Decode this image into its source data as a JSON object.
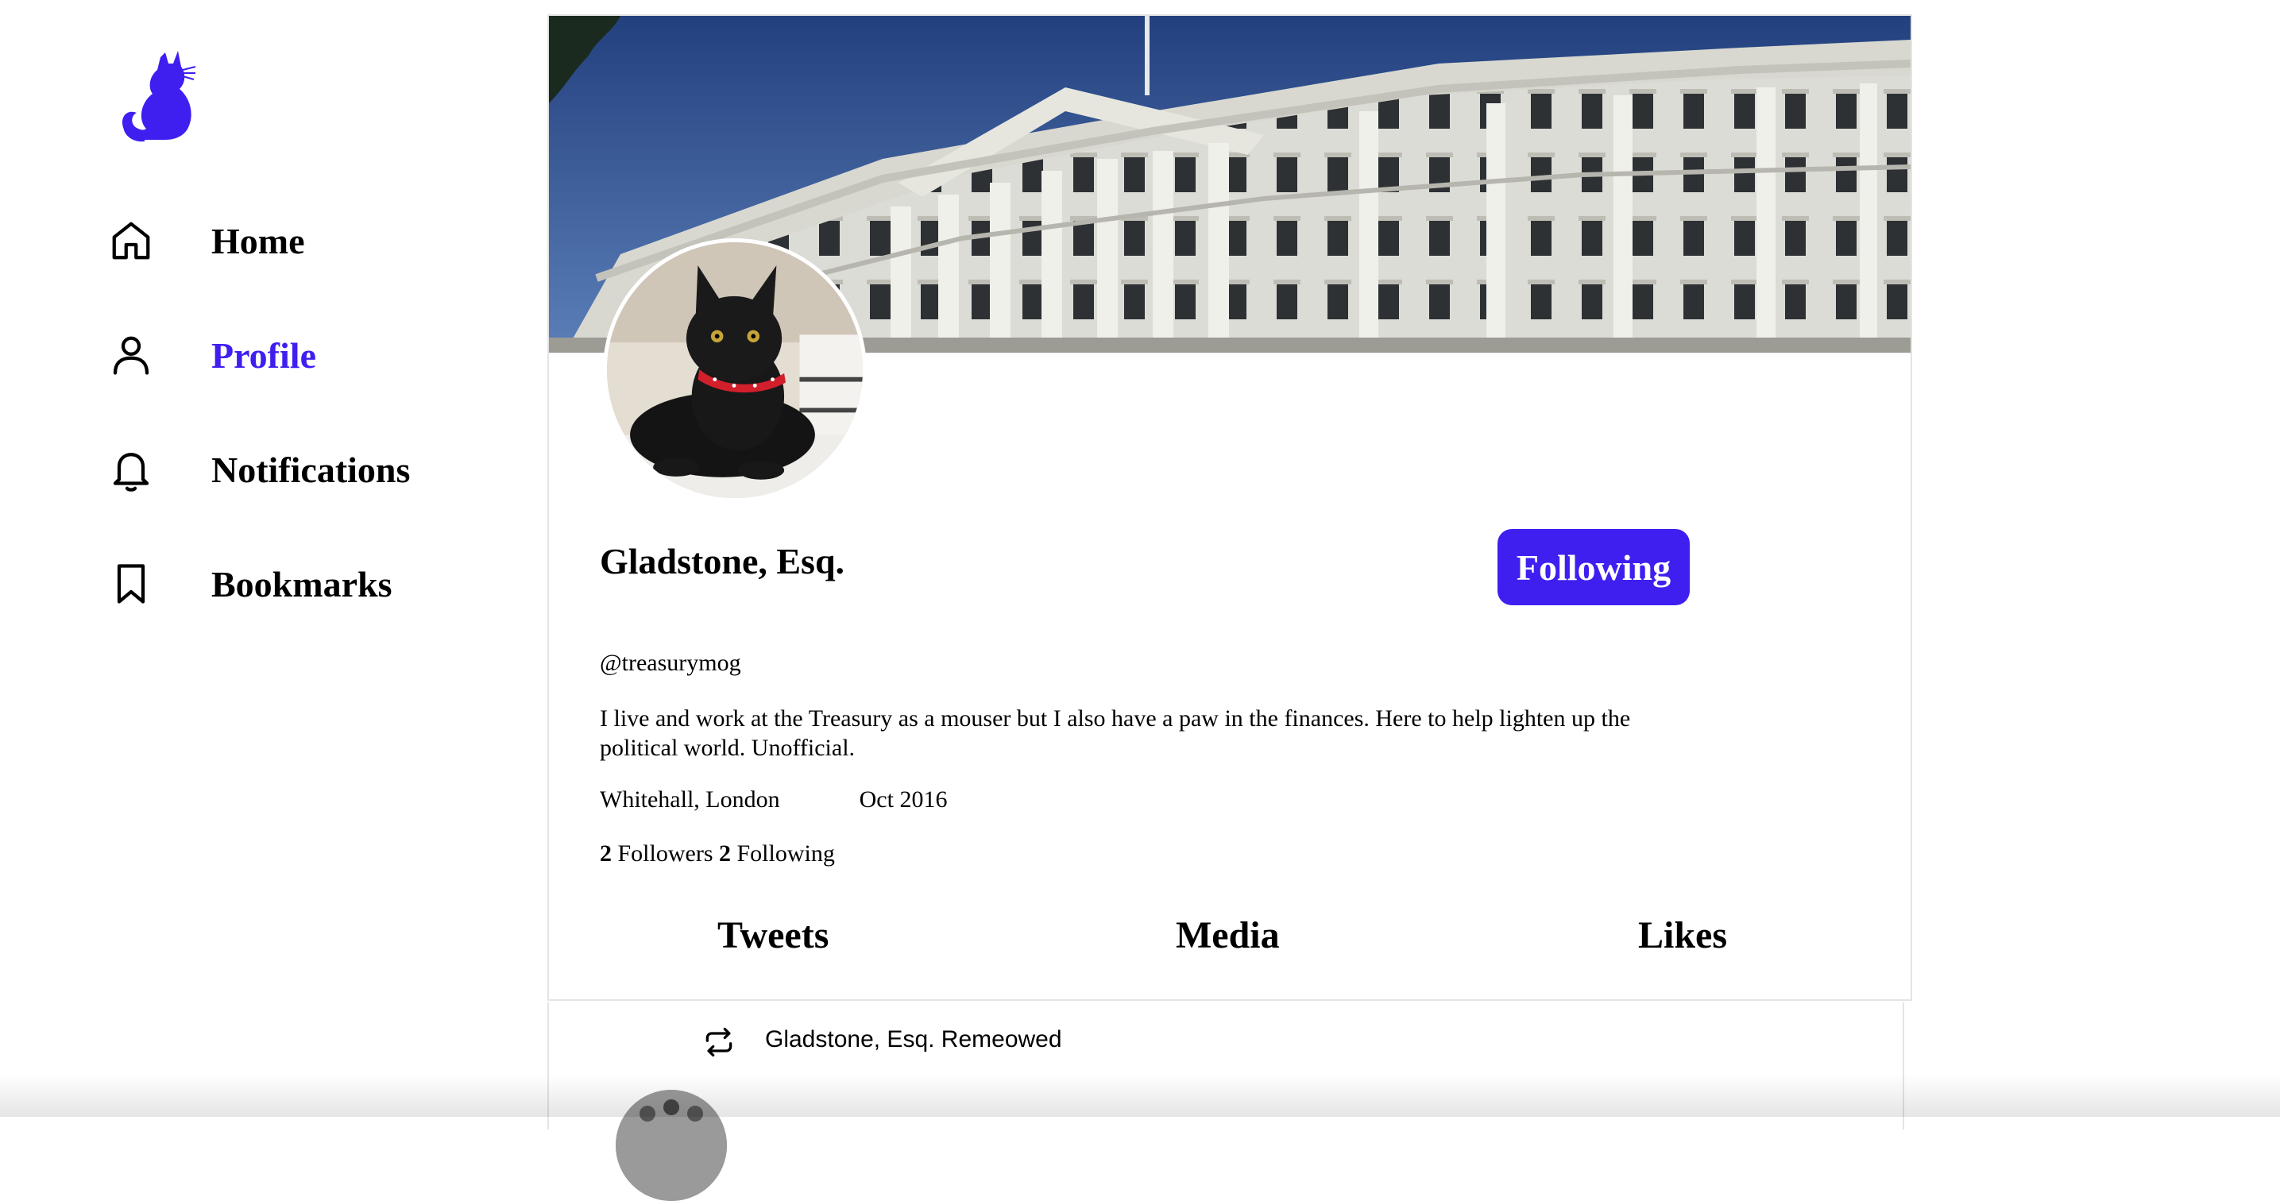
{
  "brand": {
    "logo_icon": "cat-icon",
    "accent_color": "#3e1ff0"
  },
  "sidebar": {
    "items": [
      {
        "label": "Home",
        "icon": "home-icon",
        "active": false
      },
      {
        "label": "Profile",
        "icon": "user-icon",
        "active": true
      },
      {
        "label": "Notifications",
        "icon": "bell-icon",
        "active": false
      },
      {
        "label": "Bookmarks",
        "icon": "bookmark-icon",
        "active": false
      }
    ]
  },
  "profile": {
    "banner_image": "treasury-building-banner",
    "avatar_image": "black-cat-avatar",
    "display_name": "Gladstone, Esq.",
    "follow_button_label": "Following",
    "handle": "@treasurymog",
    "bio": "I live and work at the Treasury as a mouser but I also have a paw in the finances. Here to help lighten up the political world. Unofficial.",
    "location": "Whitehall, London",
    "joined": "Oct 2016",
    "followers_count": "2",
    "followers_label": "Followers",
    "following_count": "2",
    "following_label": "Following",
    "tabs": [
      {
        "label": "Tweets"
      },
      {
        "label": "Media"
      },
      {
        "label": "Likes"
      }
    ]
  },
  "feed": {
    "items": [
      {
        "remeow_icon": "repost-icon",
        "remeow_text": "Gladstone, Esq. Remeowed"
      }
    ]
  }
}
